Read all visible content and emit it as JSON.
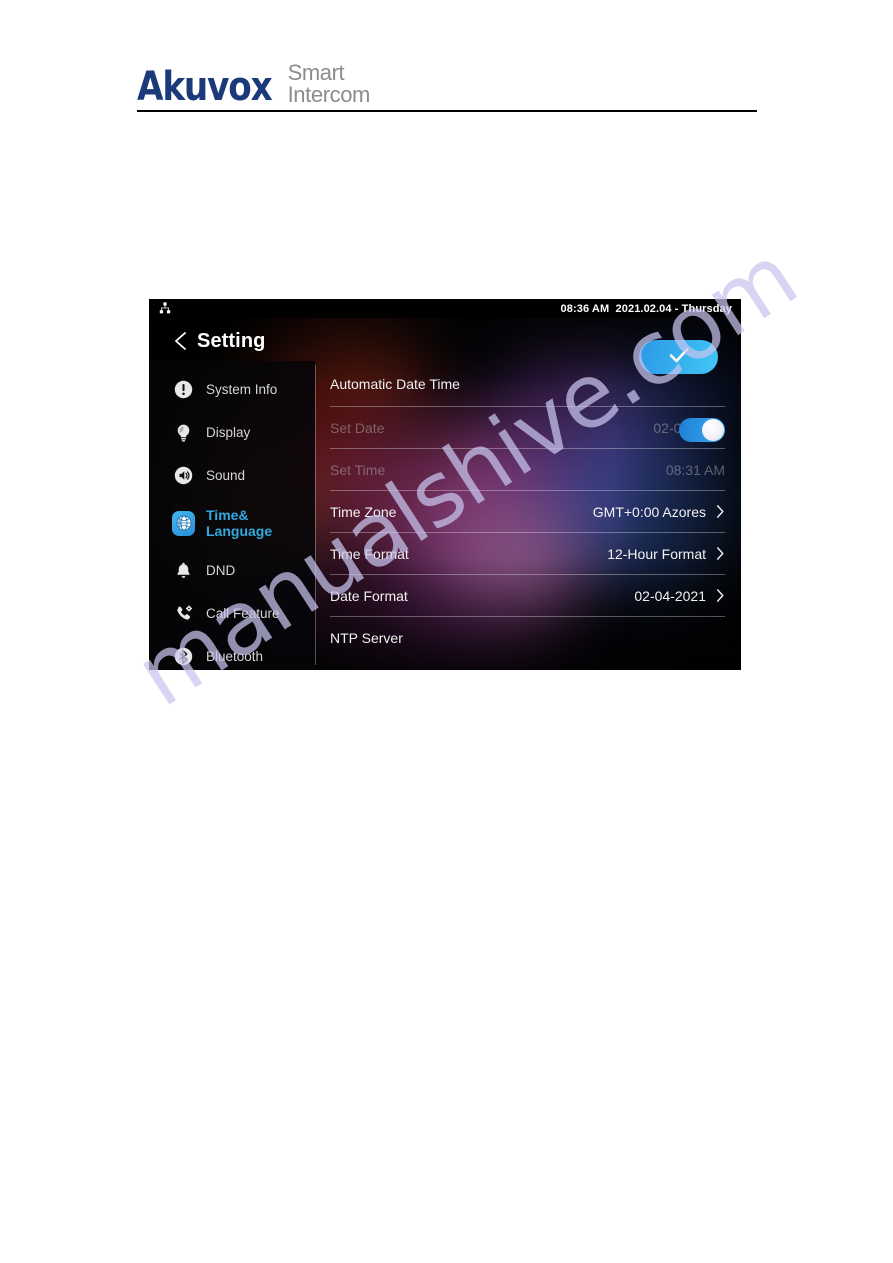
{
  "page": {
    "brand_primary": "Akuvox",
    "brand_sub_line1": "Smart",
    "brand_sub_line2": "Intercom",
    "watermark": "manualshive.com",
    "accent_color": "#31a8e0",
    "brand_color": "#1b3a7a"
  },
  "device": {
    "status_bar": {
      "network_icon": "ethernet-network-icon",
      "time_date": "08:36 AM  2021.02.04 - Thursday"
    },
    "title_bar": {
      "back_icon": "chevron-left-icon",
      "title": "Setting",
      "confirm_icon": "check-icon"
    },
    "sidebar": {
      "items": [
        {
          "label": "System Info",
          "icon": "exclamation-circle-icon",
          "active": false
        },
        {
          "label": "Display",
          "icon": "lightbulb-icon",
          "active": false
        },
        {
          "label": "Sound",
          "icon": "speaker-icon",
          "active": false
        },
        {
          "label": "Time&\nLanguage",
          "label_line1": "Time&",
          "label_line2": "Language",
          "icon": "globe-icon",
          "active": true
        },
        {
          "label": "DND",
          "icon": "bell-icon",
          "active": false
        },
        {
          "label": "Call Feature",
          "icon": "phone-gear-icon",
          "active": false
        },
        {
          "label": "Bluetooth",
          "icon": "bluetooth-icon",
          "active": false
        }
      ]
    },
    "settings": {
      "rows": [
        {
          "label": "Automatic Date Time",
          "value": "",
          "control": "toggle",
          "toggle_on": true,
          "disabled": false,
          "chevron": false
        },
        {
          "label": "Set Date",
          "value": "02-04-2021",
          "control": "value",
          "disabled": true,
          "chevron": false
        },
        {
          "label": "Set Time",
          "value": "08:31 AM",
          "control": "value",
          "disabled": true,
          "chevron": false
        },
        {
          "label": "Time Zone",
          "value": "GMT+0:00 Azores",
          "control": "value",
          "disabled": false,
          "chevron": true
        },
        {
          "label": "Time Format",
          "value": "12-Hour Format",
          "control": "value",
          "disabled": false,
          "chevron": true
        },
        {
          "label": "Date Format",
          "value": "02-04-2021",
          "control": "value",
          "disabled": false,
          "chevron": true
        },
        {
          "label": "NTP Server",
          "value": "",
          "control": "none",
          "disabled": false,
          "chevron": false
        }
      ]
    }
  }
}
